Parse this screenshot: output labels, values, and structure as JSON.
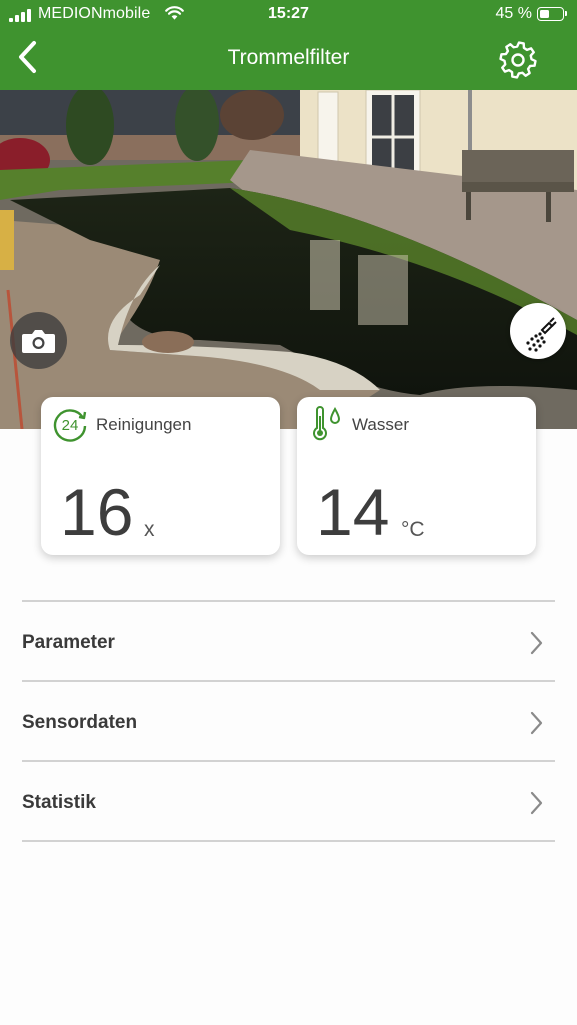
{
  "status_bar": {
    "carrier": "MEDIONmobile",
    "time": "15:27",
    "battery": "45 %",
    "battery_level": 0.45
  },
  "header": {
    "title": "Trommelfilter",
    "back_icon": "chevron-left-icon",
    "settings_icon": "gear-icon"
  },
  "photo": {
    "camera_icon": "camera-icon",
    "clean_icon": "spray-icon"
  },
  "cards": [
    {
      "icon": "24-hour-clock-icon",
      "icon_text": "24",
      "label": "Reinigungen",
      "value": "16",
      "unit": "x"
    },
    {
      "icon": "thermometer-water-icon",
      "label": "Wasser",
      "value": "14",
      "unit": "°C"
    }
  ],
  "menu": [
    {
      "label": "Parameter"
    },
    {
      "label": "Sensordaten"
    },
    {
      "label": "Statistik"
    }
  ],
  "colors": {
    "accent": "#3f932f",
    "text": "#3a3a3a",
    "divider": "#d2d2d2"
  }
}
